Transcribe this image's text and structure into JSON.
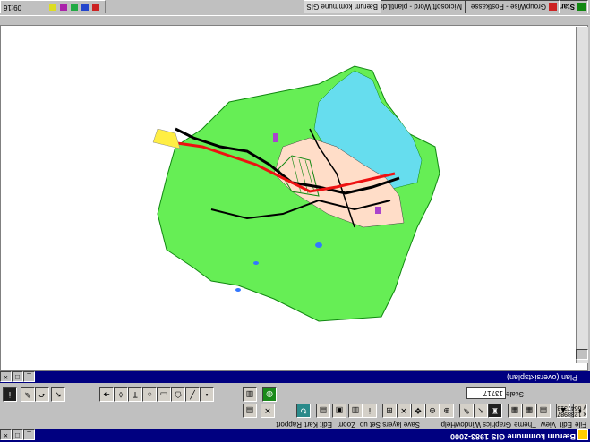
{
  "app": {
    "title": "Bærum kommune GIS 1983-2000",
    "window_buttons": [
      "_",
      "□",
      "×"
    ]
  },
  "menu": [
    "File",
    "Edit",
    "View",
    "Theme",
    "Graphics",
    "Window",
    "Help",
    "Save layers",
    "Set up",
    "Zoom",
    "Edit Kart",
    "Rapport"
  ],
  "toolbar": {
    "scale_label": "Scale 1:",
    "scale_value": "13717",
    "coord_x": "x 1238987",
    "coord_y": "y 6647313"
  },
  "view": {
    "title": "Plan (oversiktsplan)",
    "buttons": [
      "_",
      "□",
      "×"
    ]
  },
  "colors": {
    "green": "#66ee55",
    "dark_green": "#118811",
    "cyan": "#66ddee",
    "beige": "#ffddc8",
    "road": "#000000",
    "rail_red": "#ee1111",
    "yellow": "#ffee44",
    "purple": "#aa44cc",
    "titlebar": "#000080"
  },
  "taskbar": {
    "start": "Start",
    "items": [
      "GroupWise - Postkasse",
      "Microsoft Word - plantil.doc",
      "Bærum kommune GIS"
    ],
    "clock": "09:16"
  }
}
